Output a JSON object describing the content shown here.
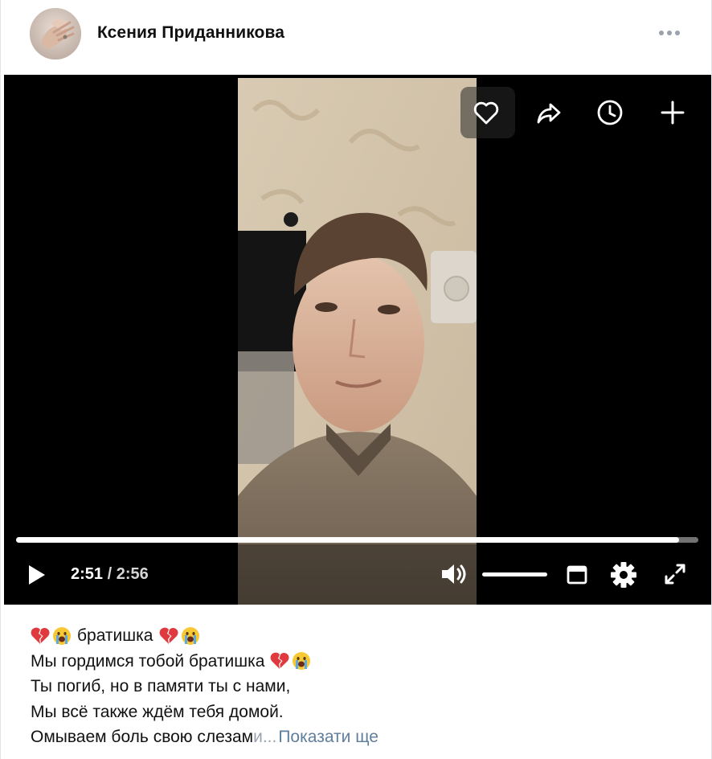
{
  "post": {
    "author": "Ксения Приданникова",
    "menu_icon": "more-horizontal-icon"
  },
  "player": {
    "current_time": "2:51",
    "separator": "/",
    "duration": "2:56",
    "progress_fraction": 0.972,
    "volume_fraction": 1.0,
    "top_actions": [
      "heart-icon",
      "share-icon",
      "watch-later-icon",
      "add-icon"
    ],
    "controls": [
      "play-icon",
      "volume-icon",
      "miniplayer-icon",
      "settings-icon",
      "fullscreen-icon"
    ]
  },
  "caption": {
    "line1_text": "братишка",
    "line2_text": "Мы гордимся тобой братишка",
    "line3_text": "Ты погиб, но в памяти ты с нами,",
    "line4_text": "Мы всё также ждём тебя домой.",
    "line5_text": "Омываем боль свою слезам",
    "line5_faded": "и...",
    "show_more": "Показати ще",
    "emojis": [
      "broken-heart-emoji",
      "crying-face-emoji"
    ]
  },
  "colors": {
    "link": "#5f7e9d",
    "meta": "#99a2ad",
    "player_bg": "#000000"
  }
}
